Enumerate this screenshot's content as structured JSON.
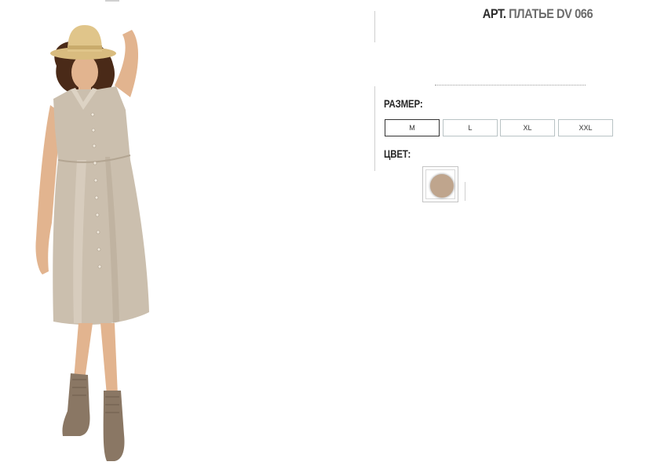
{
  "product": {
    "article_label": "АРТ.",
    "article_value": "ПЛАТЬЕ DV 066",
    "image_alt": "Льняное платье без рукавов на пуговицах"
  },
  "size_selector": {
    "label": "РАЗМЕР:",
    "options": [
      "M",
      "L",
      "XL",
      "XXL"
    ],
    "selected": "M"
  },
  "color_selector": {
    "label": "ЦВЕТ:",
    "swatches": [
      {
        "color": "#bfa58d",
        "selected": true
      }
    ]
  },
  "colors": {
    "dress": "#cbbfae",
    "hat": "#e0c58a",
    "boots": "#8a7764",
    "skin": "#e2b48f",
    "hair": "#4a2a18"
  }
}
